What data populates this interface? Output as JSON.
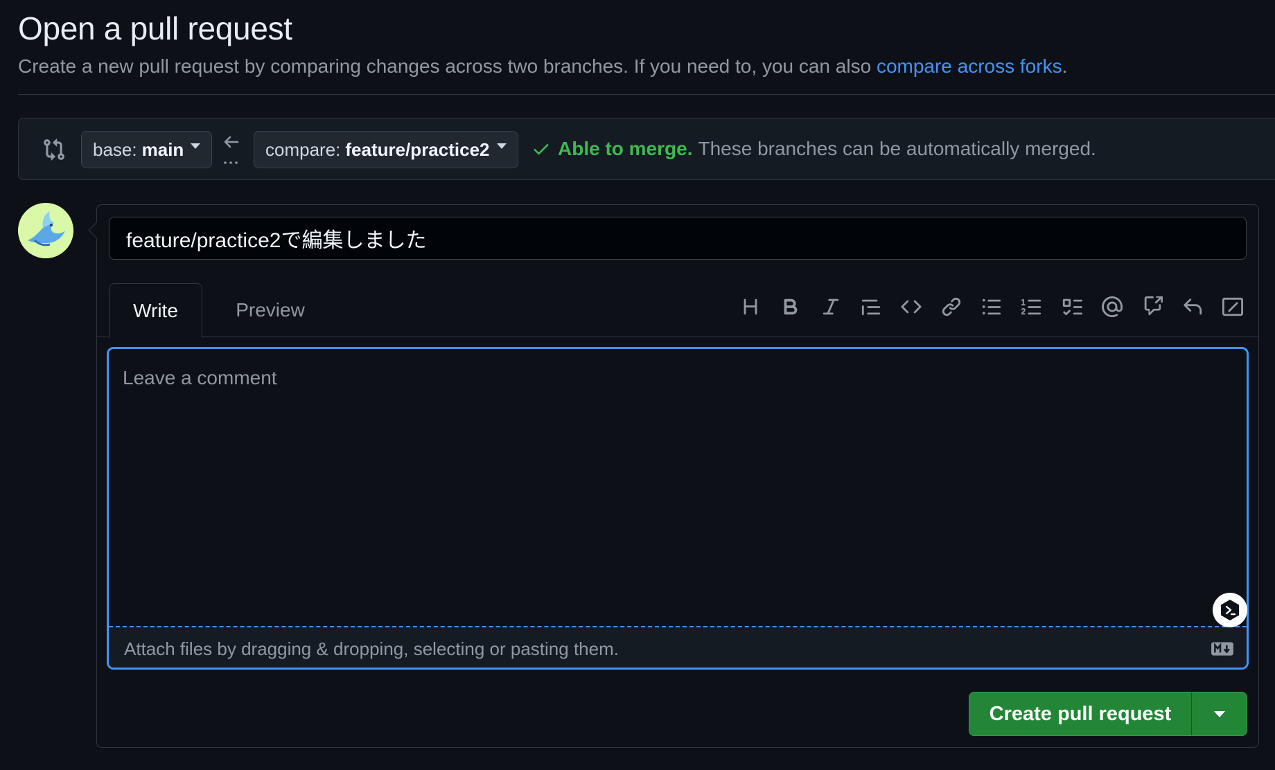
{
  "header": {
    "title": "Open a pull request",
    "subtitle": "Create a new pull request by comparing changes across two branches. If you need to, you can also ",
    "subtitle_link": "compare across forks",
    "subtitle_end": "."
  },
  "range": {
    "base_prefix": "base:",
    "base_branch": "main",
    "compare_prefix": "compare:",
    "compare_branch": "feature/practice2",
    "merge_ok": "Able to merge.",
    "merge_desc": "These branches can be automatically merged."
  },
  "form": {
    "title_value": "feature/practice2で編集しました",
    "tabs": {
      "write": "Write",
      "preview": "Preview"
    },
    "toolbar_icons": [
      "heading-icon",
      "bold-icon",
      "italic-icon",
      "quote-icon",
      "code-icon",
      "link-icon",
      "unordered-list-icon",
      "ordered-list-icon",
      "task-list-icon",
      "mention-icon",
      "cross-reference-icon",
      "undo-icon",
      "slash-commands-icon"
    ],
    "comment_placeholder": "Leave a comment",
    "attach_text": "Attach files by dragging & dropping, selecting or pasting them.",
    "submit_label": "Create pull request"
  },
  "colors": {
    "background": "#0d1117",
    "accent_blue": "#4493f8",
    "success_green": "#3fb950",
    "button_green": "#238636"
  }
}
